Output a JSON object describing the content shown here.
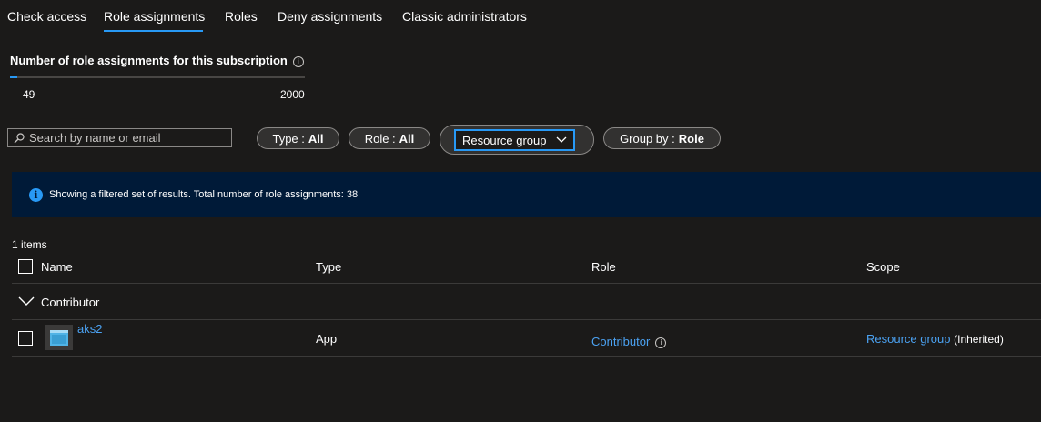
{
  "tabs": [
    {
      "label": "Check access"
    },
    {
      "label": "Role assignments",
      "active": true
    },
    {
      "label": "Roles"
    },
    {
      "label": "Deny assignments"
    },
    {
      "label": "Classic administrators"
    }
  ],
  "usage": {
    "title": "Number of role assignments for this subscription",
    "current": "49",
    "max": "2000",
    "fill_fraction": 0.0245
  },
  "search": {
    "placeholder": "Search by name or email",
    "value": ""
  },
  "filters": {
    "type": {
      "label": "Type :",
      "value": "All"
    },
    "role": {
      "label": "Role :",
      "value": "All"
    },
    "resource_group": {
      "label": "Resource group"
    },
    "group_by": {
      "label": "Group by :",
      "value": "Role"
    }
  },
  "banner": {
    "text": "Showing a filtered set of results. Total number of role assignments: 38"
  },
  "table": {
    "items_count": "1 items",
    "columns": [
      "Name",
      "Type",
      "Role",
      "Scope"
    ],
    "group": {
      "label": "Contributor"
    },
    "rows": [
      {
        "name": "aks2",
        "type": "App",
        "role": "Contributor",
        "scope_link": "Resource group",
        "scope_note": "(Inherited)"
      }
    ]
  },
  "colors": {
    "background": "#1b1a19",
    "accent": "#2899f5",
    "link": "#4ba2f2",
    "banner": "#001a38"
  }
}
